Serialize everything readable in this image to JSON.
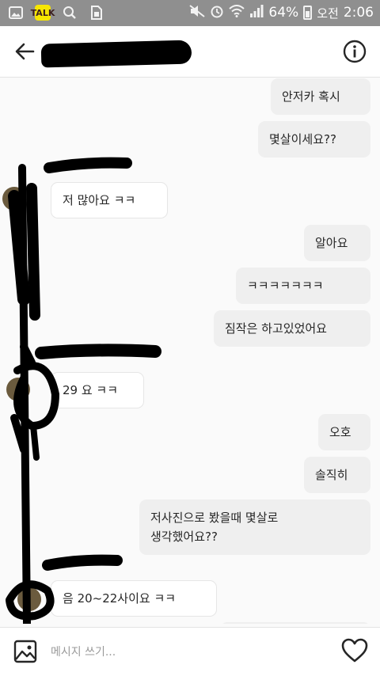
{
  "status_bar": {
    "battery_text": "64%",
    "ampm": "오전",
    "time": "2:06",
    "icons": [
      "gallery-icon",
      "kakaotalk-icon",
      "search-icon",
      "sim-icon",
      "mute-icon",
      "alarm-icon",
      "wifi-icon",
      "signal-icon",
      "battery-icon"
    ]
  },
  "header": {
    "back_icon": "back-arrow-icon",
    "username": "",
    "info_icon": "info-icon"
  },
  "messages": [
    {
      "side": "mine",
      "text": "안저카 혹시"
    },
    {
      "side": "mine",
      "text": "몇살이세요??"
    },
    {
      "side": "theirs",
      "text": "저 많아요 ㅋㅋ"
    },
    {
      "side": "mine",
      "text": "알아요"
    },
    {
      "side": "mine",
      "text": "ㅋㅋㅋㅋㅋㅋㅋ"
    },
    {
      "side": "mine",
      "text": "짐작은 하고있었어요"
    },
    {
      "side": "theirs",
      "text": "29 요 ㅋㅋ"
    },
    {
      "side": "mine",
      "text": "오호"
    },
    {
      "side": "mine",
      "text": "솔직히"
    },
    {
      "side": "mine",
      "text": "저사진으로 봤을때 몇살로\n생각했어요??"
    },
    {
      "side": "theirs",
      "text": "음 20~22사이요 ㅋㅋ"
    }
  ],
  "composer": {
    "placeholder": "메시지 쓰기...",
    "gallery_icon": "gallery-icon",
    "like_icon": "heart-icon"
  }
}
